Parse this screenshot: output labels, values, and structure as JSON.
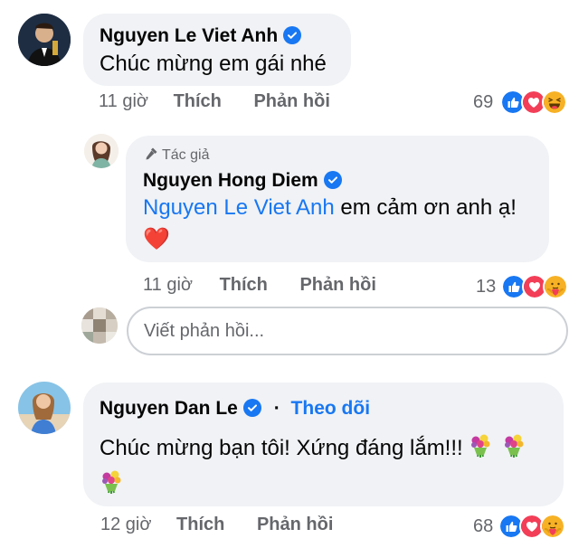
{
  "comments": [
    {
      "author": "Nguyen Le Viet Anh",
      "text": "Chúc mừng em gái nhé",
      "time": "11 giờ",
      "like_label": "Thích",
      "reply_label": "Phản hồi",
      "reaction_count": "69",
      "reactions": [
        "like-icon",
        "love-icon",
        "haha-icon"
      ]
    },
    {
      "badge": "Tác giả",
      "author": "Nguyen Hong Diem",
      "mention": "Nguyen Le Viet Anh",
      "text": "em cảm ơn anh ạ!",
      "emoji": "❤️",
      "time": "11 giờ",
      "like_label": "Thích",
      "reply_label": "Phản hồi",
      "reaction_count": "13",
      "reactions": [
        "like-icon",
        "love-icon",
        "care-icon"
      ]
    },
    {
      "author": "Nguyen Dan Le",
      "follow_label": "Theo dõi",
      "text": "Chúc mừng bạn tôi! Xứng đáng lắm!!!",
      "time": "12 giờ",
      "like_label": "Thích",
      "reply_label": "Phản hồi",
      "reaction_count": "68",
      "reactions": [
        "like-icon",
        "love-icon",
        "care-icon"
      ]
    }
  ],
  "reply_box": {
    "placeholder": "Viết phản hồi..."
  },
  "colors": {
    "bubble": "#f0f2f5",
    "link": "#1877f2",
    "meta": "#65676b"
  }
}
